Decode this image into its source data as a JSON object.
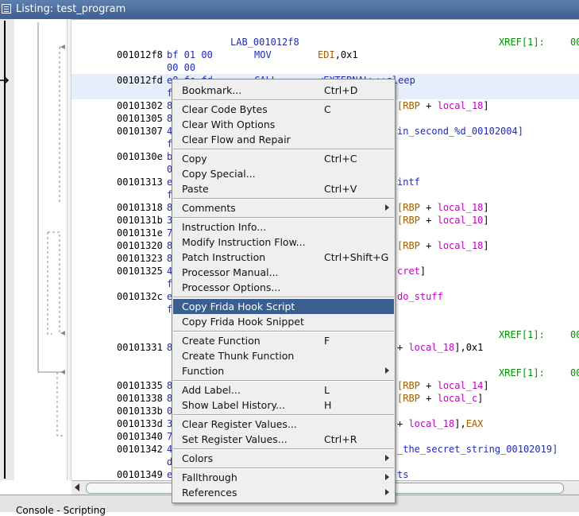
{
  "window": {
    "title": "Listing:  test_program"
  },
  "listing": {
    "lines": [
      {
        "label": "LAB_001012f8",
        "xref": "XREF[1]:",
        "xref_tail": "00"
      },
      {
        "addr": "001012f8",
        "bytes": "bf 01 00",
        "mnem": "MOV",
        "ops": [
          {
            "t": "reg",
            "v": "EDI"
          },
          {
            "t": "num",
            "v": ",0x1"
          }
        ]
      },
      {
        "bytes_cont": "00 00"
      },
      {
        "addr": "001012fd",
        "bytes": "e8 fe fd",
        "mnem": "CALL",
        "ops": [
          {
            "t": "lbl",
            "v": "<EXTERNAL>::sleep"
          }
        ]
      },
      {
        "bytes_cont": "f"
      },
      {
        "addr": "00101302",
        "bytes": "8",
        "ops_tail": [
          {
            "t": "reg",
            "v": "[RBP"
          },
          {
            "t": "num",
            "v": " + "
          },
          {
            "t": "local",
            "v": "local_18"
          },
          {
            "t": "num",
            "v": "]"
          }
        ]
      },
      {
        "addr": "00101305",
        "bytes": "8"
      },
      {
        "addr": "00101307",
        "bytes": "4",
        "ops_tail": [
          {
            "t": "lbl",
            "v": "in_second_%d_00102004]"
          }
        ]
      },
      {
        "bytes_cont": "f"
      },
      {
        "addr": "0010130e",
        "bytes": "b"
      },
      {
        "bytes_cont": "0"
      },
      {
        "addr": "00101313",
        "bytes": "e",
        "ops_tail": [
          {
            "t": "lbl",
            "v": "intf"
          }
        ]
      },
      {
        "bytes_cont": "f"
      },
      {
        "addr": "00101318",
        "bytes": "8",
        "ops_tail": [
          {
            "t": "reg",
            "v": "[RBP"
          },
          {
            "t": "num",
            "v": " + "
          },
          {
            "t": "local",
            "v": "local_18"
          },
          {
            "t": "num",
            "v": "]"
          }
        ]
      },
      {
        "addr": "0010131b",
        "bytes": "3",
        "ops_tail": [
          {
            "t": "reg",
            "v": "[RBP"
          },
          {
            "t": "num",
            "v": " + "
          },
          {
            "t": "local",
            "v": "local_10"
          },
          {
            "t": "num",
            "v": "]"
          }
        ]
      },
      {
        "addr": "0010131e",
        "bytes": "7"
      },
      {
        "addr": "00101320",
        "bytes": "8",
        "ops_tail": [
          {
            "t": "reg",
            "v": "[RBP"
          },
          {
            "t": "num",
            "v": " + "
          },
          {
            "t": "local",
            "v": "local_18"
          },
          {
            "t": "num",
            "v": "]"
          }
        ]
      },
      {
        "addr": "00101323",
        "bytes": "8"
      },
      {
        "addr": "00101325",
        "bytes": "4",
        "ops_tail": [
          {
            "t": "local",
            "v": "cret"
          },
          {
            "t": "num",
            "v": "]"
          }
        ]
      },
      {
        "bytes_cont": "f"
      },
      {
        "addr": "0010132c",
        "bytes": "e",
        "ops_tail": [
          {
            "t": "local",
            "v": "do_stuff"
          }
        ]
      },
      {
        "bytes_cont": "f"
      },
      {
        "blank": true
      },
      {
        "xref": "XREF[1]:",
        "xref_tail": "00"
      },
      {
        "addr": "00101331",
        "bytes": "8",
        "ops_tail": [
          {
            "t": "num",
            "v": "+ "
          },
          {
            "t": "local",
            "v": "local_18"
          },
          {
            "t": "num",
            "v": "],0x1"
          }
        ]
      },
      {
        "blank": true
      },
      {
        "xref": "XREF[1]:",
        "xref_tail": "00"
      },
      {
        "addr": "00101335",
        "bytes": "8",
        "ops_tail": [
          {
            "t": "reg",
            "v": "[RBP"
          },
          {
            "t": "num",
            "v": " + "
          },
          {
            "t": "local",
            "v": "local_14"
          },
          {
            "t": "num",
            "v": "]"
          }
        ]
      },
      {
        "addr": "00101338",
        "bytes": "8",
        "ops_tail": [
          {
            "t": "reg",
            "v": "[RBP"
          },
          {
            "t": "num",
            "v": " + "
          },
          {
            "t": "local",
            "v": "local_c"
          },
          {
            "t": "num",
            "v": "]"
          }
        ]
      },
      {
        "addr": "0010133b",
        "bytes": "0"
      },
      {
        "addr": "0010133d",
        "bytes": "3",
        "ops_tail": [
          {
            "t": "num",
            "v": "+ "
          },
          {
            "t": "local",
            "v": "local_18"
          },
          {
            "t": "num",
            "v": "],"
          },
          {
            "t": "reg",
            "v": "EAX"
          }
        ]
      },
      {
        "addr": "00101340",
        "bytes": "7"
      },
      {
        "addr": "00101342",
        "bytes": "4",
        "ops_tail": [
          {
            "t": "lbl",
            "v": "_the_secret_string_00102019]"
          }
        ]
      },
      {
        "bytes_cont": "d"
      },
      {
        "addr": "00101349",
        "bytes": "e",
        "ops_tail": [
          {
            "t": "lbl",
            "v": "ts"
          }
        ]
      }
    ]
  },
  "context_menu": {
    "items": [
      {
        "label": "Bookmark...",
        "accel": "Ctrl+D"
      },
      {
        "sep": true
      },
      {
        "label": "Clear Code Bytes",
        "accel": "C"
      },
      {
        "label": "Clear With Options"
      },
      {
        "label": "Clear Flow and Repair"
      },
      {
        "sep": true
      },
      {
        "label": "Copy",
        "accel": "Ctrl+C"
      },
      {
        "label": "Copy Special..."
      },
      {
        "label": "Paste",
        "accel": "Ctrl+V"
      },
      {
        "sep": true
      },
      {
        "label": "Comments",
        "submenu": true
      },
      {
        "sep": true
      },
      {
        "label": "Instruction Info..."
      },
      {
        "label": "Modify Instruction Flow..."
      },
      {
        "label": "Patch Instruction",
        "accel": "Ctrl+Shift+G"
      },
      {
        "label": "Processor Manual..."
      },
      {
        "label": "Processor Options..."
      },
      {
        "sep": true
      },
      {
        "label": "Copy Frida Hook Script",
        "selected": true
      },
      {
        "label": "Copy Frida Hook Snippet"
      },
      {
        "sep": true
      },
      {
        "label": "Create Function",
        "accel": "F"
      },
      {
        "label": "Create Thunk Function"
      },
      {
        "label": "Function",
        "submenu": true
      },
      {
        "sep": true
      },
      {
        "label": "Add Label...",
        "accel": "L"
      },
      {
        "label": "Show Label History...",
        "accel": "H"
      },
      {
        "sep": true
      },
      {
        "label": "Clear Register Values..."
      },
      {
        "label": "Set Register Values...",
        "accel": "Ctrl+R"
      },
      {
        "sep": true
      },
      {
        "label": "Colors",
        "submenu": true
      },
      {
        "sep": true
      },
      {
        "label": "Fallthrough",
        "submenu": true
      },
      {
        "label": "References",
        "submenu": true
      }
    ]
  },
  "bottom_tabs": {
    "text": "Console - Scripting"
  },
  "colors": {
    "selected_bg": "#3a5f8e",
    "highlight_line": "#e6eefb",
    "bytes": "#1f2bb5",
    "register": "#a05a00",
    "local": "#c000c0",
    "xref": "#009000"
  }
}
